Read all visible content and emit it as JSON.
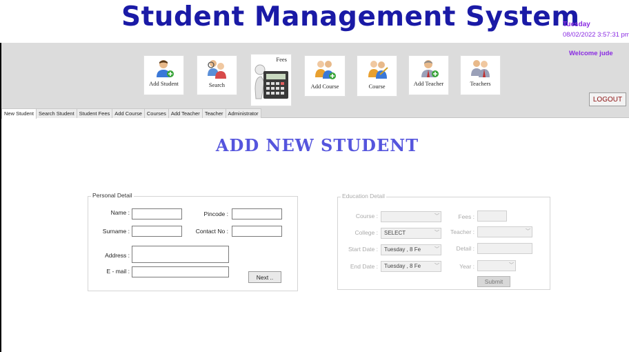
{
  "app_title": "Student Management System",
  "date": {
    "day": "Tuesday",
    "datetime": "08/02/2022 3:57:31 pm"
  },
  "welcome": "Welcome jude",
  "logout_label": "LOGOUT",
  "toolbar": [
    {
      "label": "Add Student",
      "icon": "add-student-icon"
    },
    {
      "label": "Search",
      "icon": "search-people-icon"
    },
    {
      "label": "Fees",
      "icon": "calculator-icon"
    },
    {
      "label": "Add Course",
      "icon": "add-course-icon"
    },
    {
      "label": "Course",
      "icon": "course-icon"
    },
    {
      "label": "Add Teacher",
      "icon": "add-teacher-icon"
    },
    {
      "label": "Teachers",
      "icon": "teachers-icon"
    }
  ],
  "tabs": [
    "New Student",
    "Search Student",
    "Student Fees",
    "Add Course",
    "Courses",
    "Add Teacher",
    "Teacher",
    "Administrator"
  ],
  "page_heading": "ADD NEW STUDENT",
  "personal": {
    "title": "Personal Detail",
    "name_label": "Name :",
    "pincode_label": "Pincode :",
    "surname_label": "Surname :",
    "contact_label": "Contact No :",
    "address_label": "Address :",
    "email_label": "E - mail :",
    "next_label": "Next .."
  },
  "education": {
    "title": "Education Detail",
    "course_label": "Course :",
    "fees_label": "Fees :",
    "college_label": "College :",
    "college_value": "SELECT",
    "teacher_label": "Teacher :",
    "start_label": "Start Date :",
    "start_value": "Tuesday ,  8  Fe",
    "detail_label": "Detail :",
    "end_label": "End Date :",
    "end_value": "Tuesday ,  8  Fe",
    "year_label": "Year :",
    "submit_label": "Submit"
  },
  "colors": {
    "title": "#1a1aa6",
    "accent": "#8a2be2",
    "heading": "#5555dd",
    "logout": "#8b1010"
  }
}
